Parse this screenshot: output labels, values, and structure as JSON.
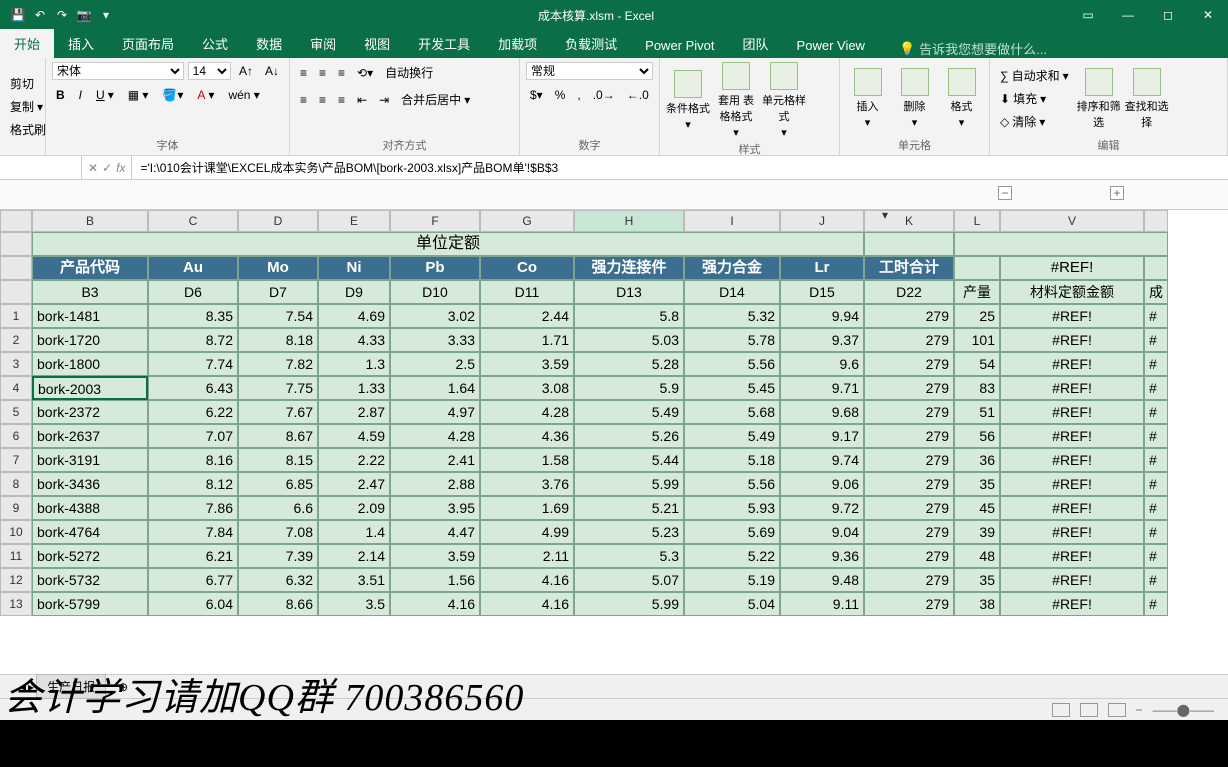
{
  "titlebar": {
    "title": "成本核算.xlsm - Excel"
  },
  "tabs": [
    "开始",
    "插入",
    "页面布局",
    "公式",
    "数据",
    "审阅",
    "视图",
    "开发工具",
    "加载项",
    "负载测试",
    "Power Pivot",
    "团队",
    "Power View"
  ],
  "tell_me": "告诉我您想要做什么...",
  "ribbon": {
    "clipboard": {
      "cut": "剪切",
      "copy": "复制",
      "format_painter": "格式刷",
      "label": ""
    },
    "font": {
      "name": "宋体",
      "size": "14",
      "label": "字体"
    },
    "align": {
      "wrap": "自动换行",
      "merge": "合并后居中",
      "label": "对齐方式"
    },
    "number": {
      "format": "常规",
      "label": "数字"
    },
    "styles": {
      "cond": "条件格式",
      "table": "套用\n表格格式",
      "cell": "单元格样式",
      "label": "样式"
    },
    "cells": {
      "insert": "插入",
      "delete": "删除",
      "format": "格式",
      "label": "单元格"
    },
    "editing": {
      "sum": "自动求和",
      "fill": "填充",
      "clear": "清除",
      "sort": "排序和筛选",
      "find": "查找和选择",
      "label": "编辑"
    }
  },
  "formula_bar": {
    "name_box": "",
    "fx_label": "fx",
    "formula": "='I:\\010会计课堂\\EXCEL成本实务\\产品BOM\\[bork-2003.xlsx]产品BOM单'!$B$3"
  },
  "columns": [
    "",
    "B",
    "C",
    "D",
    "E",
    "F",
    "G",
    "H",
    "I",
    "J",
    "K",
    "L",
    "V",
    ""
  ],
  "section_title": "单位定额",
  "header1": [
    "产品代码",
    "Au",
    "Mo",
    "Ni",
    "Pb",
    "Co",
    "强力连接件",
    "强力合金",
    "Lr",
    "工时合计",
    "",
    "#REF!",
    ""
  ],
  "header2": [
    "B3",
    "D6",
    "D7",
    "D9",
    "D10",
    "D11",
    "D13",
    "D14",
    "D15",
    "D22",
    "产量",
    "材料定额金额",
    "成"
  ],
  "rows": [
    {
      "n": 1,
      "code": "bork-1481",
      "v": [
        8.35,
        7.54,
        4.69,
        3.02,
        2.44,
        5.8,
        5.32,
        9.94,
        279
      ],
      "q": 25,
      "ref": "#REF!"
    },
    {
      "n": 2,
      "code": "bork-1720",
      "v": [
        8.72,
        8.18,
        4.33,
        3.33,
        1.71,
        5.03,
        5.78,
        9.37,
        279
      ],
      "q": 101,
      "ref": "#REF!"
    },
    {
      "n": 3,
      "code": "bork-1800",
      "v": [
        7.74,
        7.82,
        1.3,
        2.5,
        3.59,
        5.28,
        5.56,
        9.6,
        279
      ],
      "q": 54,
      "ref": "#REF!"
    },
    {
      "n": 4,
      "code": "bork-2003",
      "v": [
        6.43,
        7.75,
        1.33,
        1.64,
        3.08,
        5.9,
        5.45,
        9.71,
        279
      ],
      "q": 83,
      "ref": "#REF!"
    },
    {
      "n": 5,
      "code": "bork-2372",
      "v": [
        6.22,
        7.67,
        2.87,
        4.97,
        4.28,
        5.49,
        5.68,
        9.68,
        279
      ],
      "q": 51,
      "ref": "#REF!"
    },
    {
      "n": 6,
      "code": "bork-2637",
      "v": [
        7.07,
        8.67,
        4.59,
        4.28,
        4.36,
        5.26,
        5.49,
        9.17,
        279
      ],
      "q": 56,
      "ref": "#REF!"
    },
    {
      "n": 7,
      "code": "bork-3191",
      "v": [
        8.16,
        8.15,
        2.22,
        2.41,
        1.58,
        5.44,
        5.18,
        9.74,
        279
      ],
      "q": 36,
      "ref": "#REF!"
    },
    {
      "n": 8,
      "code": "bork-3436",
      "v": [
        8.12,
        6.85,
        2.47,
        2.88,
        3.76,
        5.99,
        5.56,
        9.06,
        279
      ],
      "q": 35,
      "ref": "#REF!"
    },
    {
      "n": 9,
      "code": "bork-4388",
      "v": [
        7.86,
        6.6,
        2.09,
        3.95,
        1.69,
        5.21,
        5.93,
        9.72,
        279
      ],
      "q": 45,
      "ref": "#REF!"
    },
    {
      "n": 10,
      "code": "bork-4764",
      "v": [
        7.84,
        7.08,
        1.4,
        4.47,
        4.99,
        5.23,
        5.69,
        9.04,
        279
      ],
      "q": 39,
      "ref": "#REF!"
    },
    {
      "n": 11,
      "code": "bork-5272",
      "v": [
        6.21,
        7.39,
        2.14,
        3.59,
        2.11,
        5.3,
        5.22,
        9.36,
        279
      ],
      "q": 48,
      "ref": "#REF!"
    },
    {
      "n": 12,
      "code": "bork-5732",
      "v": [
        6.77,
        6.32,
        3.51,
        1.56,
        4.16,
        5.07,
        5.19,
        9.48,
        279
      ],
      "q": 35,
      "ref": "#REF!"
    },
    {
      "n": 13,
      "code": "bork-5799",
      "v": [
        6.04,
        8.66,
        3.5,
        4.16,
        4.16,
        5.99,
        5.04,
        9.11,
        279
      ],
      "q": 38,
      "ref": "#REF!"
    }
  ],
  "sheet_tabs": [
    "生产日报"
  ],
  "sheet_tab_add": "⊕",
  "overlay": "会计学习请加QQ群 700386560",
  "ref_marker": "#"
}
